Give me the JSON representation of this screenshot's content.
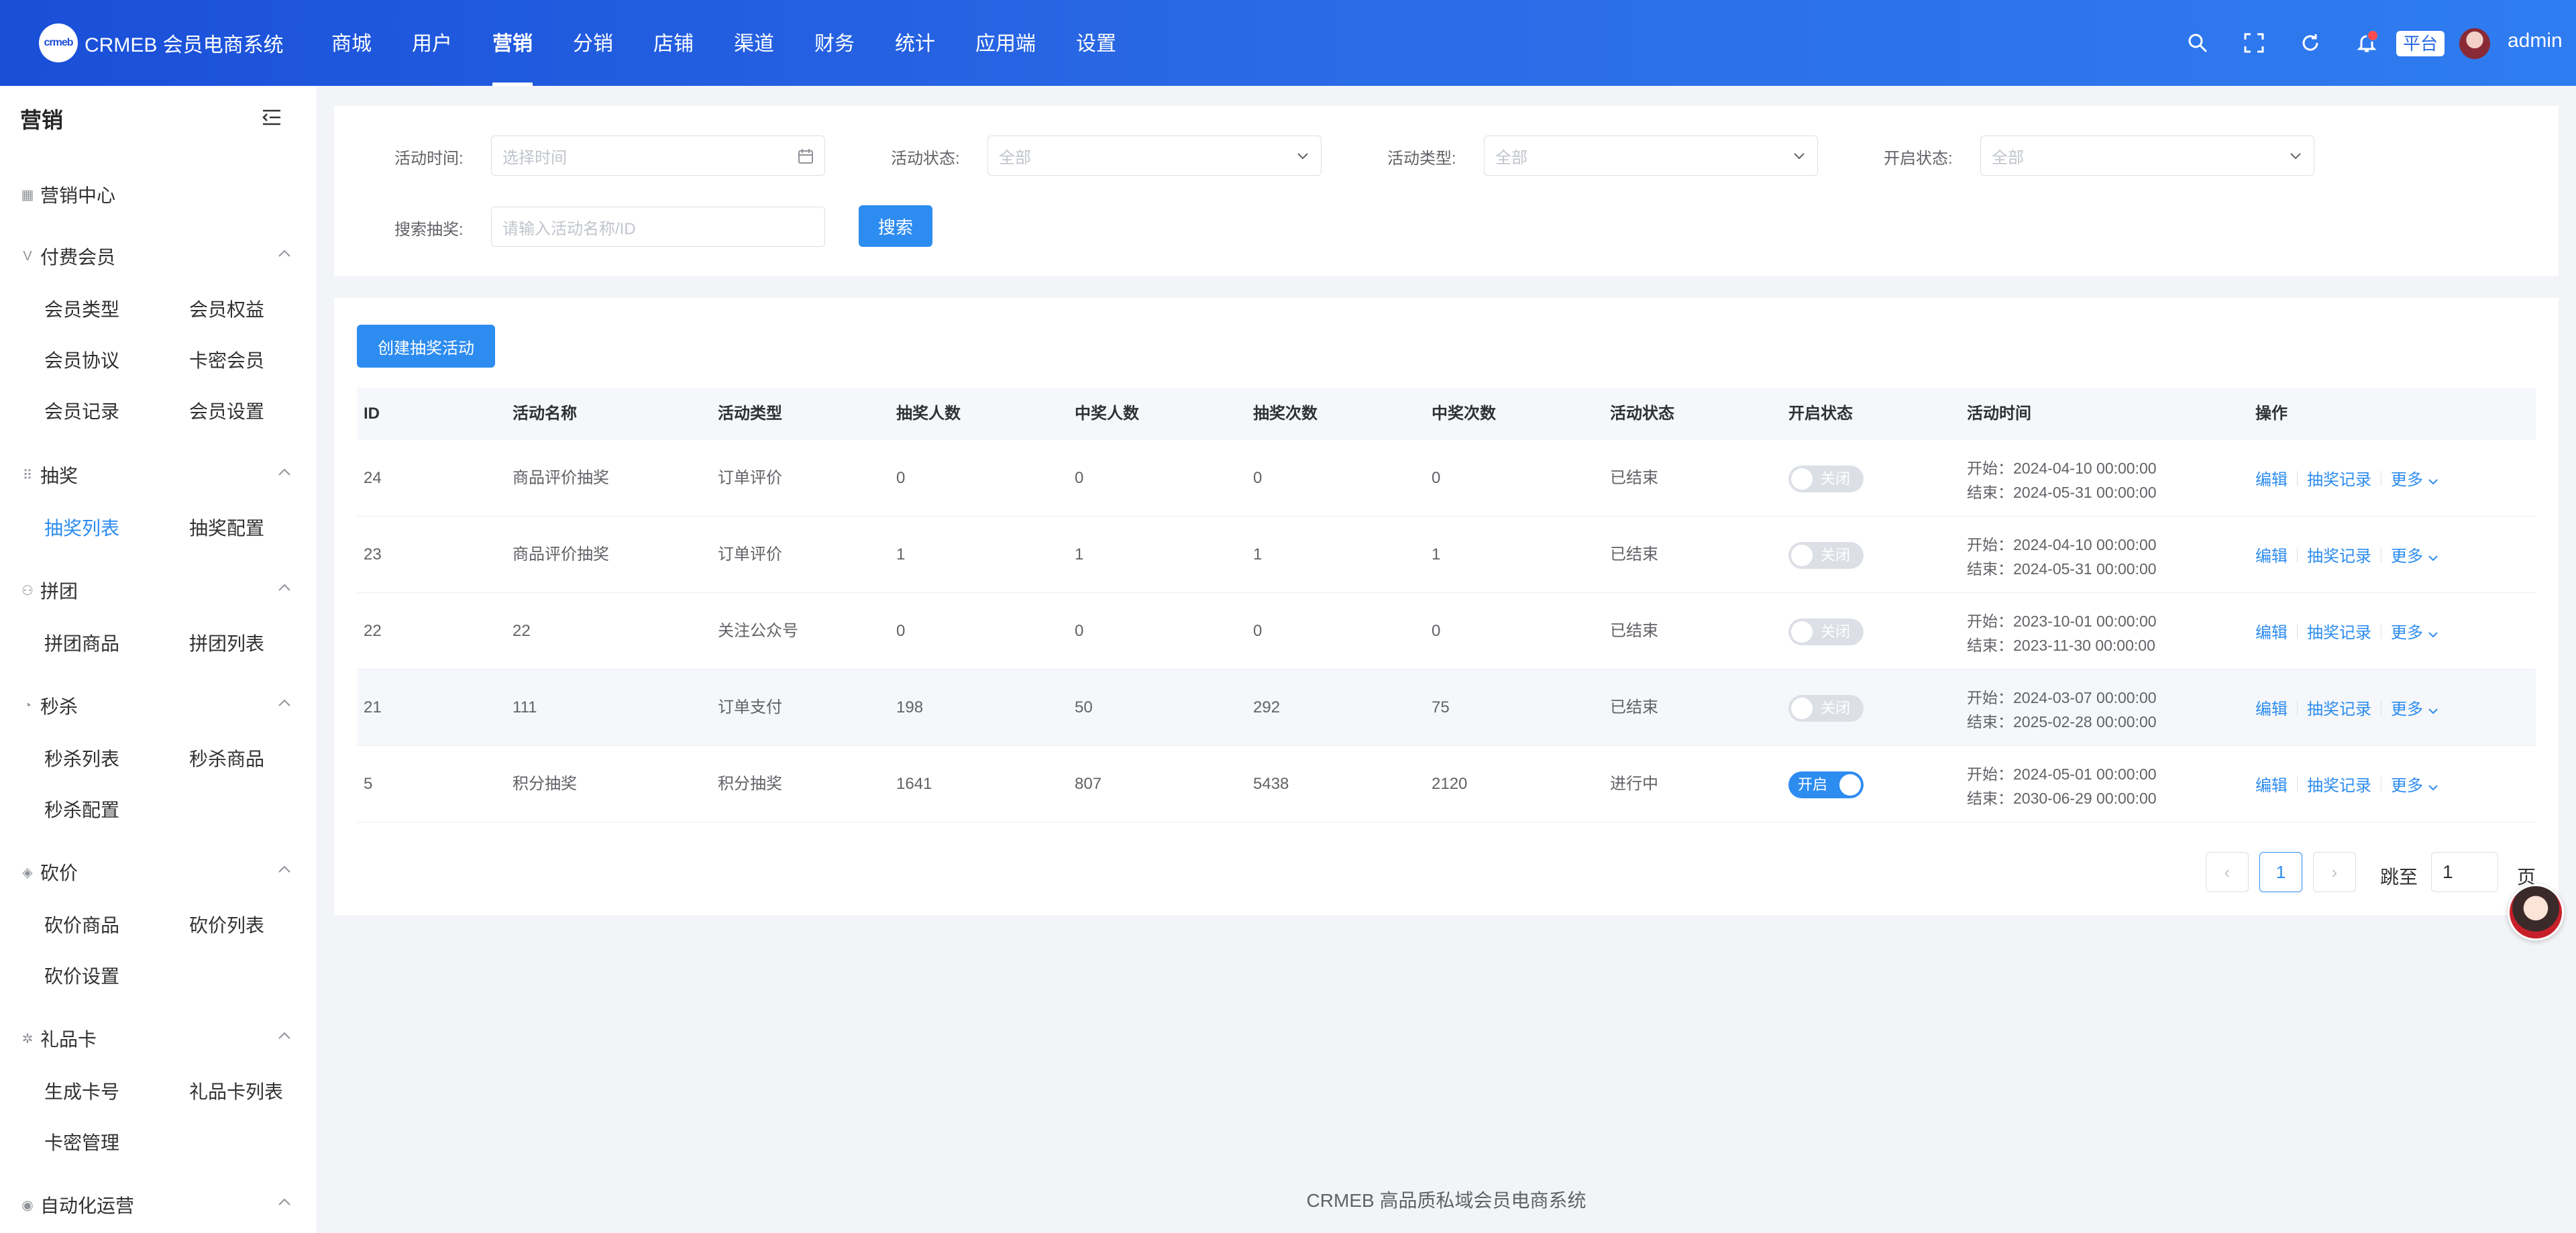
{
  "brand": {
    "logo_text": "crmeb",
    "name": "CRMEB 会员电商系统"
  },
  "topnav": [
    "商城",
    "用户",
    "营销",
    "分销",
    "店铺",
    "渠道",
    "财务",
    "统计",
    "应用端",
    "设置"
  ],
  "header": {
    "platform_tag": "平台",
    "username": "admin"
  },
  "sidebar": {
    "title": "营销",
    "marketing_center": "营销中心",
    "groups": {
      "paid_member": {
        "label": "付费会员",
        "items": [
          "会员类型",
          "会员权益",
          "会员协议",
          "卡密会员",
          "会员记录",
          "会员设置"
        ]
      },
      "lottery": {
        "label": "抽奖",
        "items": [
          "抽奖列表",
          "抽奖配置"
        ]
      },
      "group_buy": {
        "label": "拼团",
        "items": [
          "拼团商品",
          "拼团列表"
        ]
      },
      "seckill": {
        "label": "秒杀",
        "items": [
          "秒杀列表",
          "秒杀商品",
          "秒杀配置"
        ]
      },
      "bargain": {
        "label": "砍价",
        "items": [
          "砍价商品",
          "砍价列表",
          "砍价设置"
        ]
      },
      "gift_card": {
        "label": "礼品卡",
        "items": [
          "生成卡号",
          "礼品卡列表",
          "卡密管理"
        ]
      },
      "automation": {
        "label": "自动化运营"
      }
    }
  },
  "filters": {
    "time_label": "活动时间:",
    "time_placeholder": "选择时间",
    "status_label": "活动状态:",
    "status_value": "全部",
    "type_label": "活动类型:",
    "type_value": "全部",
    "open_label": "开启状态:",
    "open_value": "全部",
    "search_label": "搜索抽奖:",
    "search_placeholder": "请输入活动名称/ID",
    "search_button": "搜索"
  },
  "create_button": "创建抽奖活动",
  "table": {
    "headers": [
      "ID",
      "活动名称",
      "活动类型",
      "抽奖人数",
      "中奖人数",
      "抽奖次数",
      "中奖次数",
      "活动状态",
      "开启状态",
      "活动时间",
      "操作"
    ],
    "rows": [
      {
        "id": "24",
        "name": "商品评价抽奖",
        "type": "订单评价",
        "draw_users": "0",
        "win_users": "0",
        "draw_times": "0",
        "win_times": "0",
        "status": "已结束",
        "open": false,
        "toggle_label": "关闭",
        "start": "开始：2024-04-10 00:00:00",
        "end": "结束：2024-05-31 00:00:00"
      },
      {
        "id": "23",
        "name": "商品评价抽奖",
        "type": "订单评价",
        "draw_users": "1",
        "win_users": "1",
        "draw_times": "1",
        "win_times": "1",
        "status": "已结束",
        "open": false,
        "toggle_label": "关闭",
        "start": "开始：2024-04-10 00:00:00",
        "end": "结束：2024-05-31 00:00:00"
      },
      {
        "id": "22",
        "name": "22",
        "type": "关注公众号",
        "draw_users": "0",
        "win_users": "0",
        "draw_times": "0",
        "win_times": "0",
        "status": "已结束",
        "open": false,
        "toggle_label": "关闭",
        "start": "开始：2023-10-01 00:00:00",
        "end": "结束：2023-11-30 00:00:00"
      },
      {
        "id": "21",
        "name": "111",
        "type": "订单支付",
        "draw_users": "198",
        "win_users": "50",
        "draw_times": "292",
        "win_times": "75",
        "status": "已结束",
        "open": false,
        "toggle_label": "关闭",
        "start": "开始：2024-03-07 00:00:00",
        "end": "结束：2025-02-28 00:00:00"
      },
      {
        "id": "5",
        "name": "积分抽奖",
        "type": "积分抽奖",
        "draw_users": "1641",
        "win_users": "807",
        "draw_times": "5438",
        "win_times": "2120",
        "status": "进行中",
        "open": true,
        "toggle_label": "开启",
        "start": "开始：2024-05-01 00:00:00",
        "end": "结束：2030-06-29 00:00:00"
      }
    ],
    "actions": {
      "edit": "编辑",
      "records": "抽奖记录",
      "more": "更多"
    }
  },
  "pagination": {
    "current": "1",
    "jump_label": "跳至",
    "jump_value": "1",
    "page_suffix": "页"
  },
  "footer": "CRMEB 高品质私域会员电商系统",
  "colors": {
    "header_start": "#1a4fd8",
    "header_end": "#2f7cf0",
    "accent": "#2d8cf0"
  }
}
